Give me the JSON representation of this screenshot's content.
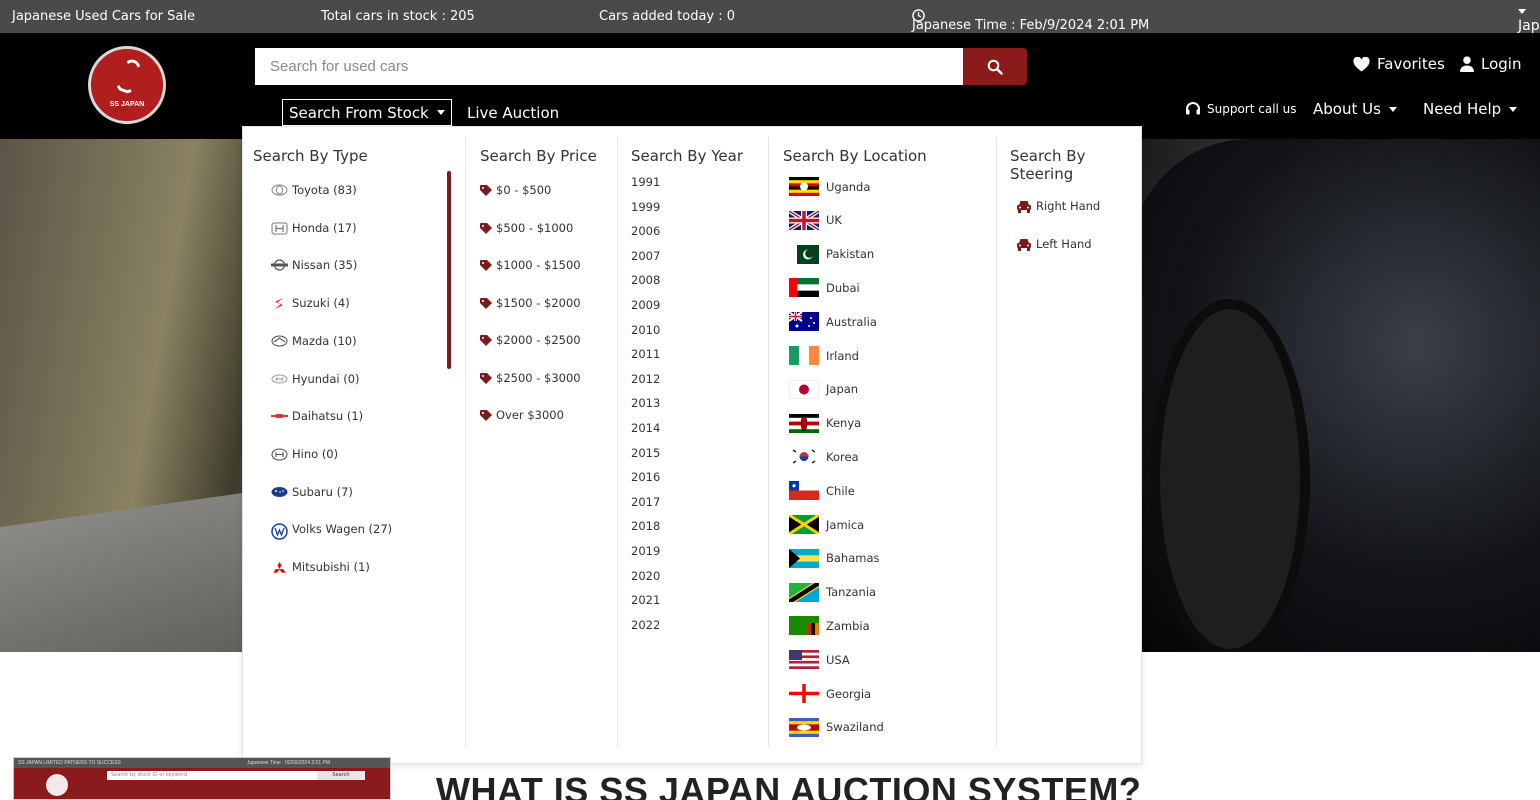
{
  "topbar": {
    "tagline": "Japanese Used Cars for Sale",
    "total_stock": "Total cars in stock : 205",
    "added_today": "Cars added today : 0",
    "japan_time": "Japanese Time : Feb/9/2024 2:01 PM",
    "country": "Japan"
  },
  "header": {
    "logo_text": "SS JAPAN",
    "search_placeholder": "Search for used cars",
    "favorites": "Favorites",
    "login": "Login",
    "search_from_stock": "Search From Stock",
    "live_auction": "Live Auction",
    "support": "Support call us",
    "about_us": "About Us",
    "need_help": "Need Help"
  },
  "mega_menu": {
    "type_title": "Search By Type",
    "types": [
      {
        "label": "Toyota (83)",
        "icon": "toyota-logo"
      },
      {
        "label": "Honda (17)",
        "icon": "honda-logo"
      },
      {
        "label": "Nissan (35)",
        "icon": "nissan-logo"
      },
      {
        "label": "Suzuki (4)",
        "icon": "suzuki-logo"
      },
      {
        "label": "Mazda (10)",
        "icon": "mazda-logo"
      },
      {
        "label": "Hyundai (0)",
        "icon": "hyundai-logo"
      },
      {
        "label": "Daihatsu (1)",
        "icon": "daihatsu-logo"
      },
      {
        "label": "Hino (0)",
        "icon": "hino-logo"
      },
      {
        "label": "Subaru (7)",
        "icon": "subaru-logo"
      },
      {
        "label": "Volks Wagen (27)",
        "icon": "vw-logo"
      },
      {
        "label": "Mitsubishi (1)",
        "icon": "mitsubishi-logo"
      }
    ],
    "price_title": "Search By Price",
    "prices": [
      "$0 - $500",
      "$500 - $1000",
      "$1000 - $1500",
      "$1500 - $2000",
      "$2000 - $2500",
      "$2500 - $3000",
      "Over $3000"
    ],
    "year_title": "Search By Year",
    "years": [
      "1991",
      "1999",
      "2006",
      "2007",
      "2008",
      "2009",
      "2010",
      "2011",
      "2012",
      "2013",
      "2014",
      "2015",
      "2016",
      "2017",
      "2018",
      "2019",
      "2020",
      "2021",
      "2022"
    ],
    "location_title": "Search By Location",
    "locations": [
      {
        "label": "Uganda",
        "icon": "uganda-flag"
      },
      {
        "label": "UK",
        "icon": "uk-flag"
      },
      {
        "label": "Pakistan",
        "icon": "pakistan-flag"
      },
      {
        "label": "Dubai",
        "icon": "uae-flag"
      },
      {
        "label": "Australia",
        "icon": "australia-flag"
      },
      {
        "label": "Irland",
        "icon": "ireland-flag"
      },
      {
        "label": "Japan",
        "icon": "japan-flag"
      },
      {
        "label": "Kenya",
        "icon": "kenya-flag"
      },
      {
        "label": "Korea",
        "icon": "korea-flag"
      },
      {
        "label": "Chile",
        "icon": "chile-flag"
      },
      {
        "label": "Jamica",
        "icon": "jamaica-flag"
      },
      {
        "label": "Bahamas",
        "icon": "bahamas-flag"
      },
      {
        "label": "Tanzania",
        "icon": "tanzania-flag"
      },
      {
        "label": "Zambia",
        "icon": "zambia-flag"
      },
      {
        "label": "USA",
        "icon": "usa-flag"
      },
      {
        "label": "Georgia",
        "icon": "georgia-flag"
      },
      {
        "label": "Swaziland",
        "icon": "swaziland-flag"
      }
    ],
    "steering_title": "Search By Steering",
    "steering": [
      "Right Hand",
      "Left Hand"
    ]
  },
  "thumbnail": {
    "top_text": "SS JAPAN LIMITED PATNERS TO SUCCESS",
    "time_text": "Japanese Time : 02/09/2024 2:01 PM",
    "search_placeholder": "Search by stock ID or keyword",
    "search_button": "Search"
  },
  "headline": "WHAT IS SS JAPAN AUCTION SYSTEM?",
  "colors": {
    "accent": "#8b1a1a",
    "topbar": "#4a4a4a",
    "header": "#000000"
  }
}
